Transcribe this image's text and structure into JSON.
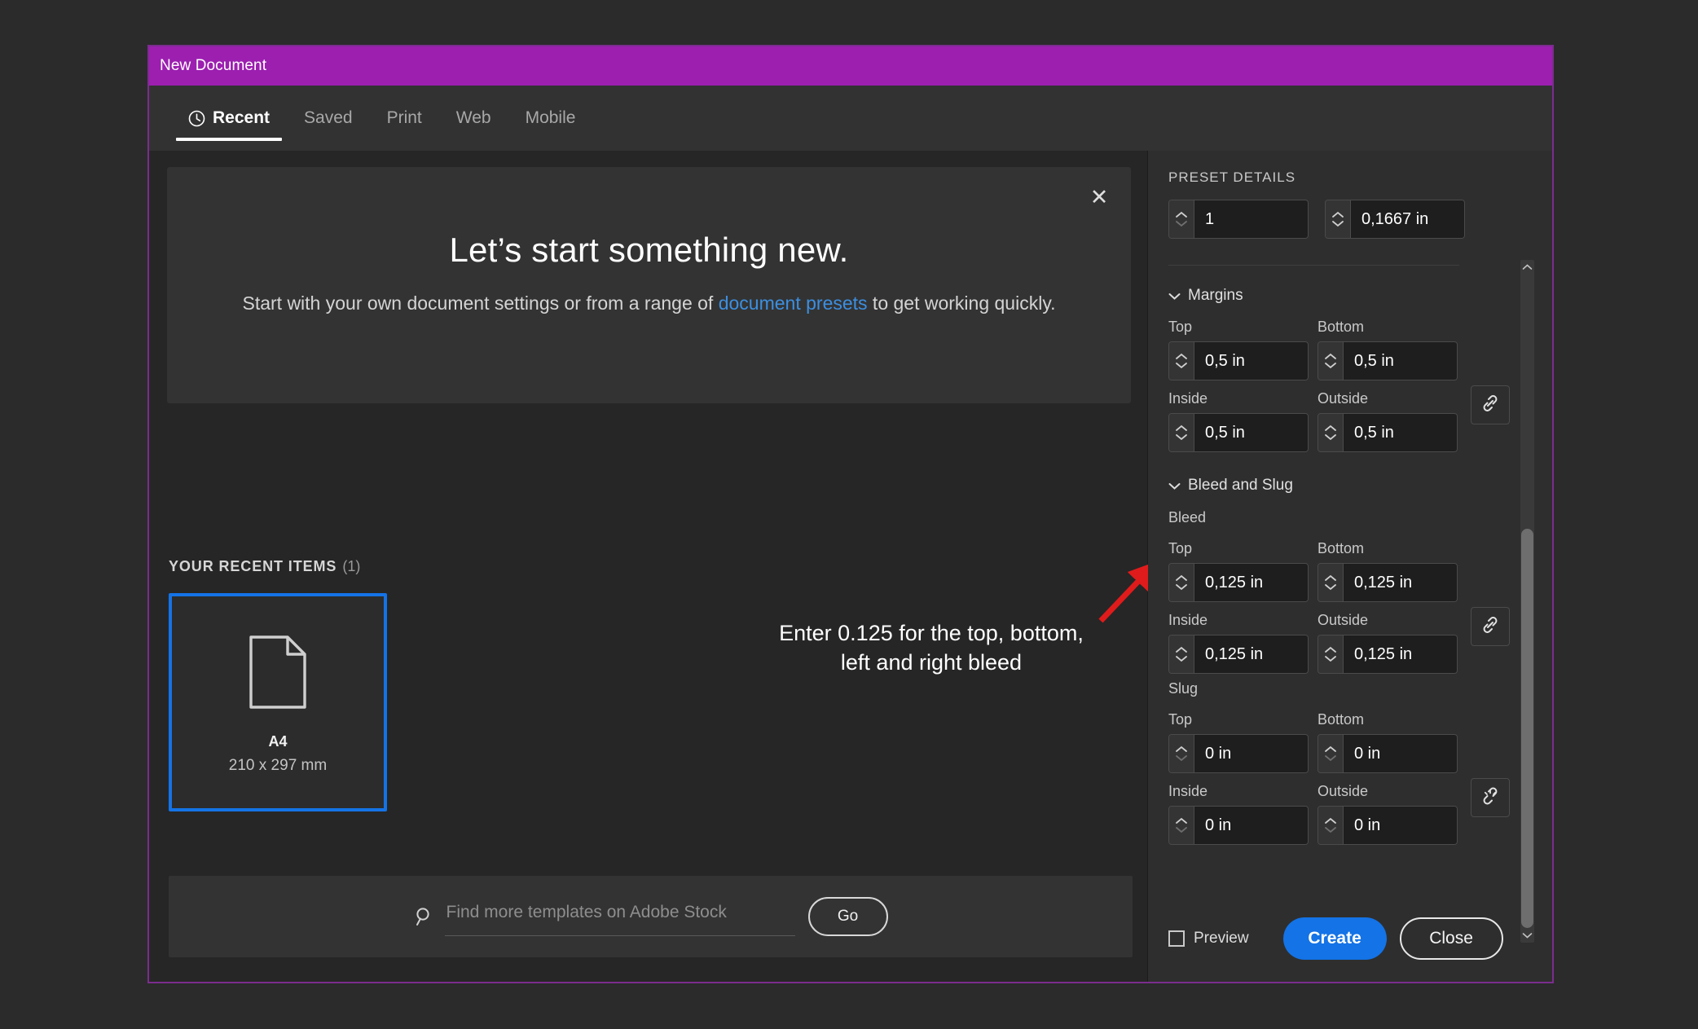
{
  "window": {
    "title": "New Document"
  },
  "tabs": [
    {
      "label": "Recent",
      "icon": "clock-icon",
      "active": true
    },
    {
      "label": "Saved",
      "active": false
    },
    {
      "label": "Print",
      "active": false
    },
    {
      "label": "Web",
      "active": false
    },
    {
      "label": "Mobile",
      "active": false
    }
  ],
  "hero": {
    "heading": "Let’s start something new.",
    "body_part1": "Start with your own document settings or from a range of ",
    "link": "document presets",
    "body_part2": " to get working quickly.",
    "close_icon": "✕"
  },
  "recent": {
    "heading": "YOUR RECENT ITEMS",
    "count": "(1)",
    "items": [
      {
        "name": "A4",
        "dimensions": "210 x 297 mm",
        "icon": "document-icon",
        "selected": true
      }
    ]
  },
  "search": {
    "placeholder": "Find more templates on Adobe Stock",
    "value": "",
    "button_label": "Go",
    "icon": "search-icon"
  },
  "annotation": {
    "text_line1": "Enter 0.125 for the top, bottom,",
    "text_line2": "left and right bleed",
    "arrow_color": "#e01b1b"
  },
  "preset_details": {
    "title": "PRESET DETAILS",
    "top_row": [
      {
        "name": "pages",
        "value": "1"
      },
      {
        "name": "column-gutter",
        "value": "0,1667 in"
      }
    ],
    "margins": {
      "section_label": "Margins",
      "expanded": true,
      "fields": [
        {
          "label": "Top",
          "value": "0,5 in"
        },
        {
          "label": "Bottom",
          "value": "0,5 in"
        },
        {
          "label": "Inside",
          "value": "0,5 in"
        },
        {
          "label": "Outside",
          "value": "0,5 in"
        }
      ],
      "link_state": "linked",
      "link_icon": "link-icon"
    },
    "bleed_and_slug": {
      "section_label": "Bleed and Slug",
      "expanded": true,
      "bleed": {
        "group_label": "Bleed",
        "fields": [
          {
            "label": "Top",
            "value": "0,125 in"
          },
          {
            "label": "Bottom",
            "value": "0,125 in"
          },
          {
            "label": "Inside",
            "value": "0,125 in"
          },
          {
            "label": "Outside",
            "value": "0,125 in"
          }
        ],
        "link_state": "linked",
        "link_icon": "link-icon"
      },
      "slug": {
        "group_label": "Slug",
        "fields": [
          {
            "label": "Top",
            "value": "0 in"
          },
          {
            "label": "Bottom",
            "value": "0 in"
          },
          {
            "label": "Inside",
            "value": "0 in"
          },
          {
            "label": "Outside",
            "value": "0 in"
          }
        ],
        "link_state": "unlinked",
        "link_icon": "broken-link-icon"
      }
    }
  },
  "footer": {
    "preview_label": "Preview",
    "preview_checked": false,
    "create_label": "Create",
    "close_label": "Close"
  },
  "colors": {
    "titlebar": "#9c1fb0",
    "window_border": "#7b2d8e",
    "accent_blue": "#1473e6",
    "link_blue": "#3c8fe0",
    "panel_bg": "#2e2e2e",
    "content_bg": "#262626",
    "banner_bg": "#333333",
    "annotation_arrow": "#e01b1b"
  }
}
